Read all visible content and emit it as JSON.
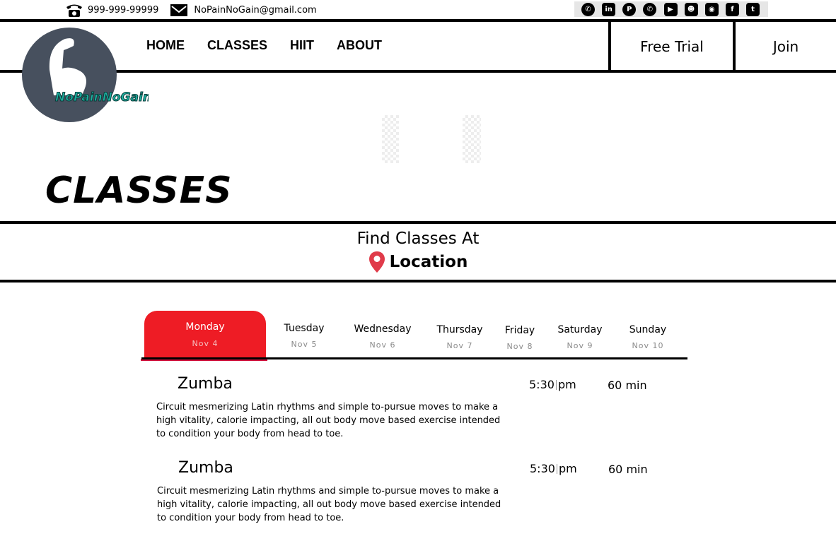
{
  "contact": {
    "phone": "999-999-99999",
    "email": "NoPainNoGain@gmail.com"
  },
  "socials": [
    "viber-icon",
    "linkedin-icon",
    "pinterest-icon",
    "whatsapp-icon",
    "youtube-icon",
    "snapchat-icon",
    "instagram-icon",
    "facebook-icon",
    "twitter-icon"
  ],
  "logo": {
    "text": "NoPainNoGain",
    "text_color": "#1db0a0",
    "circle_color": "#47505e"
  },
  "nav": {
    "items": [
      "HOME",
      "CLASSES",
      "HIIT",
      "ABOUT"
    ]
  },
  "header_buttons": {
    "free_trial": "Free Trial",
    "join": "Join"
  },
  "page_title": "CLASSES",
  "location": {
    "heading": "Find Classes At",
    "label": "Location",
    "pin_color": "#e03b4a"
  },
  "days": [
    {
      "day": "Monday",
      "date": "Nov 4",
      "active": true
    },
    {
      "day": "Tuesday",
      "date": "Nov 5"
    },
    {
      "day": "Wednesday",
      "date": "Nov 6"
    },
    {
      "day": "Thursday",
      "date": "Nov 7"
    },
    {
      "day": "Friday",
      "date": "Nov 8"
    },
    {
      "day": "Saturday",
      "date": "Nov 9"
    },
    {
      "day": "Sunday",
      "date": "Nov 10"
    }
  ],
  "accent_color": "#ee1c25",
  "classes": [
    {
      "name": "Zumba",
      "description": "Circuit mesmerizing Latin rhythms and simple to-pursue moves to make a high vitality, calorie impacting, all out body move based exercise intended to condition your body from head to toe.",
      "time": "5:30",
      "ampm": "pm",
      "duration": "60 min"
    },
    {
      "name": "Zumba",
      "description": "Circuit mesmerizing Latin rhythms and simple to-pursue moves to make a high vitality, calorie impacting, all out body move based exercise intended to condition your body from head to toe.",
      "time": "5:30",
      "ampm": "pm",
      "duration": "60 min"
    }
  ]
}
